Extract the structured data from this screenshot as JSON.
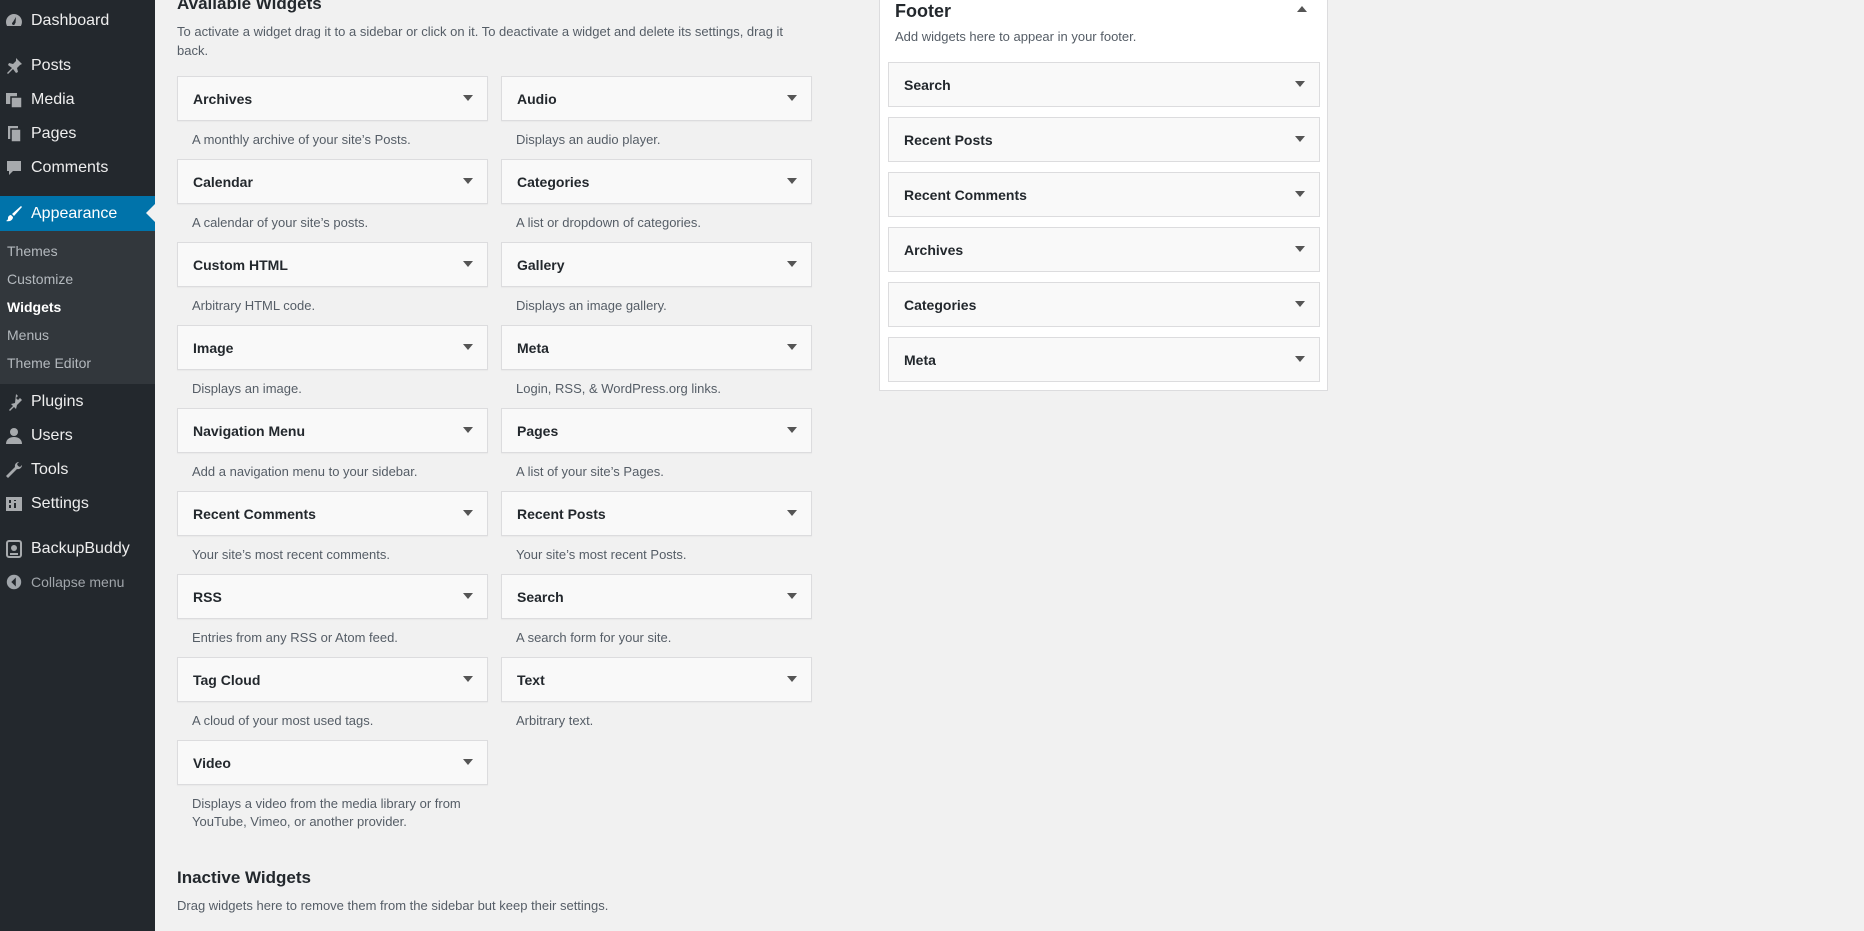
{
  "sidebar": {
    "items": [
      {
        "label": "Dashboard",
        "icon": "dashboard-icon"
      },
      {
        "label": "Posts",
        "icon": "pin-icon"
      },
      {
        "label": "Media",
        "icon": "media-icon"
      },
      {
        "label": "Pages",
        "icon": "pages-icon"
      },
      {
        "label": "Comments",
        "icon": "comment-icon"
      },
      {
        "label": "Appearance",
        "icon": "brush-icon"
      },
      {
        "label": "Plugins",
        "icon": "plugin-icon"
      },
      {
        "label": "Users",
        "icon": "user-icon"
      },
      {
        "label": "Tools",
        "icon": "wrench-icon"
      },
      {
        "label": "Settings",
        "icon": "settings-icon"
      },
      {
        "label": "BackupBuddy",
        "icon": "backupbuddy-icon"
      }
    ],
    "submenu": [
      "Themes",
      "Customize",
      "Widgets",
      "Menus",
      "Theme Editor"
    ],
    "collapse_label": "Collapse menu",
    "accent": "#0073aa"
  },
  "available": {
    "title": "Available Widgets",
    "description": "To activate a widget drag it to a sidebar or click on it. To deactivate a widget and delete its settings, drag it back.",
    "widgets": [
      {
        "title": "Archives",
        "desc": "A monthly archive of your site’s Posts."
      },
      {
        "title": "Audio",
        "desc": "Displays an audio player."
      },
      {
        "title": "Calendar",
        "desc": "A calendar of your site’s posts."
      },
      {
        "title": "Categories",
        "desc": "A list or dropdown of categories."
      },
      {
        "title": "Custom HTML",
        "desc": "Arbitrary HTML code."
      },
      {
        "title": "Gallery",
        "desc": "Displays an image gallery."
      },
      {
        "title": "Image",
        "desc": "Displays an image."
      },
      {
        "title": "Meta",
        "desc": "Login, RSS, & WordPress.org links."
      },
      {
        "title": "Navigation Menu",
        "desc": "Add a navigation menu to your sidebar."
      },
      {
        "title": "Pages",
        "desc": "A list of your site’s Pages."
      },
      {
        "title": "Recent Comments",
        "desc": "Your site’s most recent comments."
      },
      {
        "title": "Recent Posts",
        "desc": "Your site’s most recent Posts."
      },
      {
        "title": "RSS",
        "desc": "Entries from any RSS or Atom feed."
      },
      {
        "title": "Search",
        "desc": "A search form for your site."
      },
      {
        "title": "Tag Cloud",
        "desc": "A cloud of your most used tags."
      },
      {
        "title": "Text",
        "desc": "Arbitrary text."
      },
      {
        "title": "Video",
        "desc": "Displays a video from the media library or from YouTube, Vimeo, or another provider."
      }
    ]
  },
  "inactive": {
    "title": "Inactive Widgets",
    "description": "Drag widgets here to remove them from the sidebar but keep their settings."
  },
  "footer": {
    "title": "Footer",
    "description": "Add widgets here to appear in your footer.",
    "widgets": [
      "Search",
      "Recent Posts",
      "Recent Comments",
      "Archives",
      "Categories",
      "Meta"
    ]
  }
}
